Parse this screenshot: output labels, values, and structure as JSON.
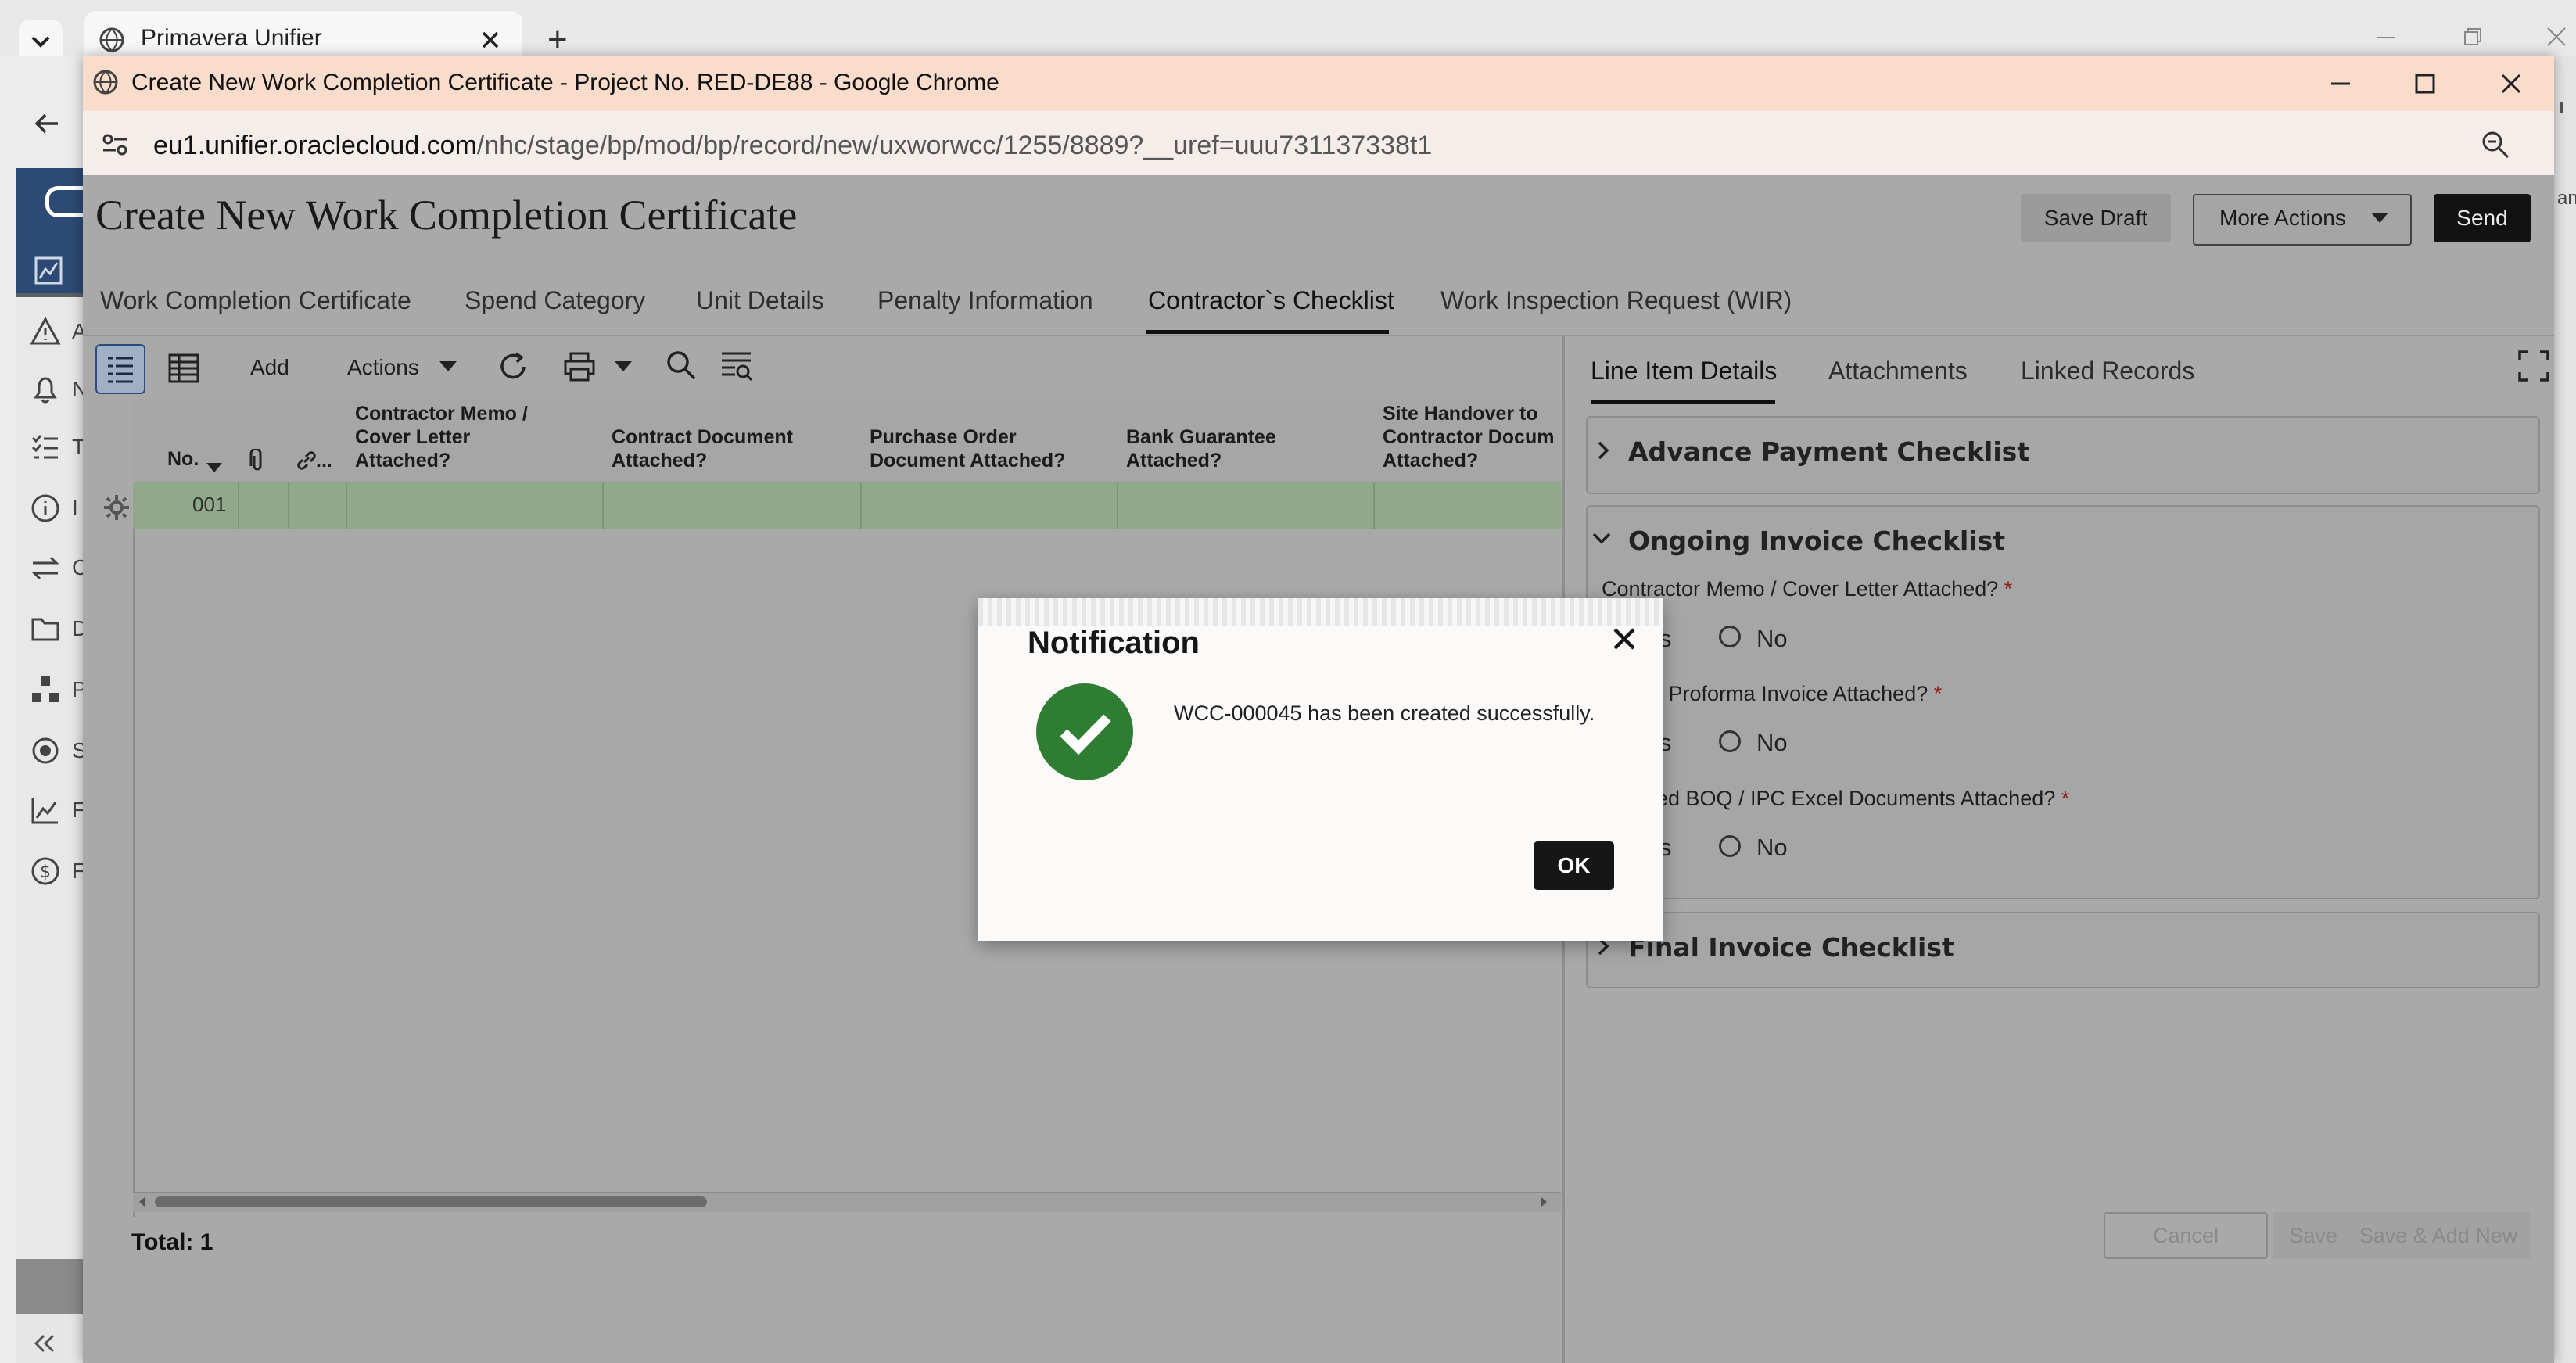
{
  "outer_browser": {
    "tab_title": "Primavera Unifier",
    "new_tab": "+",
    "sidebar_truncated": [
      "A",
      "N",
      "T",
      "I",
      "C",
      "D",
      "P",
      "S",
      "F",
      "F"
    ],
    "right_truncated": "an"
  },
  "popup": {
    "window_title": "Create New Work Completion Certificate - Project No. RED-DE88 - Google Chrome",
    "url_domain": "eu1.unifier.oraclecloud.com",
    "url_path": "/nhc/stage/bp/mod/bp/record/new/uxworwcc/1255/8889?__uref=uuu731137338t1"
  },
  "header": {
    "title": "Create New Work Completion Certificate",
    "save_draft": "Save Draft",
    "more_actions": "More Actions",
    "send": "Send"
  },
  "tabs": [
    {
      "label": "Work Completion Certificate"
    },
    {
      "label": "Spend Category"
    },
    {
      "label": "Unit Details"
    },
    {
      "label": "Penalty Information"
    },
    {
      "label": "Contractor`s Checklist",
      "active": true
    },
    {
      "label": "Work Inspection Request (WIR)"
    }
  ],
  "toolbar": {
    "add": "Add",
    "actions": "Actions"
  },
  "grid": {
    "columns": {
      "no": "No.",
      "attach": "",
      "link": "...",
      "memo_l1": "Contractor Memo /",
      "memo_l2": "Cover Letter",
      "memo_l3": "Attached?",
      "contract_l1": "Contract Document",
      "contract_l2": "Attached?",
      "po_l1": "Purchase Order",
      "po_l2": "Document Attached?",
      "bank_l1": "Bank Guarantee",
      "bank_l2": "Attached?",
      "site_l1": "Site Handover to",
      "site_l2": "Contractor Docum",
      "site_l3": "Attached?"
    },
    "rows": [
      {
        "no": "001"
      }
    ],
    "total": "Total: 1"
  },
  "right_panel": {
    "tabs": [
      "Line Item Details",
      "Attachments",
      "Linked Records"
    ],
    "sections": {
      "advance": "Advance Payment Checklist",
      "ongoing": "Ongoing Invoice Checklist",
      "final": "Final Invoice Checklist"
    },
    "fields": [
      {
        "label": "Contractor Memo / Cover Letter Attached?",
        "yes_partial": "s",
        "no": "No"
      },
      {
        "label": "ng Proforma Invoice Attached?",
        "yes_partial": "s",
        "no": "No"
      },
      {
        "label": "ed BOQ / IPC Excel Documents Attached?",
        "yes_partial": "s",
        "no": "No"
      }
    ],
    "required_mark": "*",
    "footer": {
      "cancel": "Cancel",
      "save": "Save",
      "save_add_new": "Save & Add New"
    }
  },
  "dialog": {
    "title": "Notification",
    "message": "WCC-000045 has been created successfully.",
    "ok": "OK"
  },
  "colors": {
    "accent": "#2d4a75",
    "success": "#2e7d32",
    "title_bar": "#f9dccb"
  },
  "icons": [
    "chevron-down-icon",
    "globe-icon",
    "close-icon",
    "back-arrow-icon",
    "site-info-icon",
    "zoom-icon",
    "list-view-icon",
    "table-view-icon",
    "refresh-icon",
    "print-icon",
    "search-icon",
    "filter-icon",
    "gear-icon",
    "attachment-icon",
    "link-icon",
    "expand-icon",
    "check-icon"
  ]
}
